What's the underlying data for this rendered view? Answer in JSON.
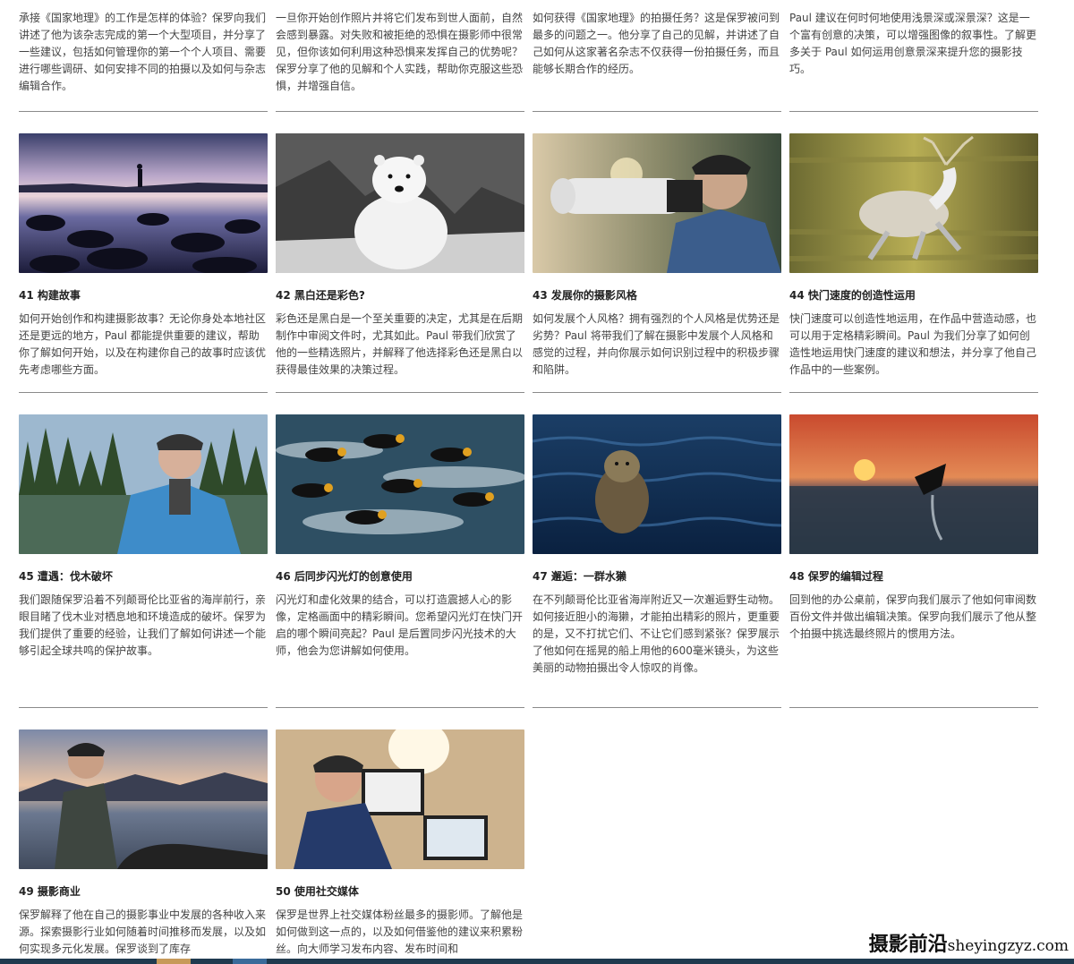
{
  "row0": [
    {
      "desc": "承接《国家地理》的工作是怎样的体验？保罗向我们讲述了他为该杂志完成的第一个大型项目，并分享了一些建议，包括如何管理你的第一个个人项目、需要进行哪些调研、如何安排不同的拍摄以及如何与杂志编辑合作。"
    },
    {
      "desc": "一旦你开始创作照片并将它们发布到世人面前，自然会感到暴露。对失败和被拒绝的恐惧在摄影师中很常见，但你该如何利用这种恐惧来发挥自己的优势呢？保罗分享了他的见解和个人实践，帮助你克服这些恐惧，并增强自信。"
    },
    {
      "desc": "如何获得《国家地理》的拍摄任务？这是保罗被问到最多的问题之一。他分享了自己的见解，并讲述了自己如何从这家著名杂志不仅获得一份拍摄任务，而且能够长期合作的经历。"
    },
    {
      "desc": "Paul 建议在何时何地使用浅景深或深景深？这是一个富有创意的决策，可以增强图像的叙事性。了解更多关于 Paul 如何运用创意景深来提升您的摄影技巧。"
    }
  ],
  "row1": [
    {
      "title": "41 构建故事",
      "desc": "如何开始创作和构建摄影故事？无论你身处本地社区还是更远的地方，Paul 都能提供重要的建议，帮助你了解如何开始，以及在构建你自己的故事时应该优先考虑哪些方面。"
    },
    {
      "title": "42 黑白还是彩色?",
      "desc": "彩色还是黑白是一个至关重要的决定，尤其是在后期制作中审阅文件时，尤其如此。Paul 带我们欣赏了他的一些精选照片，并解释了他选择彩色还是黑白以获得最佳效果的决策过程。"
    },
    {
      "title": "43 发展你的摄影风格",
      "desc": "如何发展个人风格？拥有强烈的个人风格是优势还是劣势？Paul 将带我们了解在摄影中发展个人风格和感觉的过程，并向你展示如何识别过程中的积极步骤和陷阱。"
    },
    {
      "title": "44 快门速度的创造性运用",
      "desc": "快门速度可以创造性地运用，在作品中营造动感，也可以用于定格精彩瞬间。Paul 为我们分享了如何创造性地运用快门速度的建议和想法，并分享了他自己作品中的一些案例。"
    }
  ],
  "row2": [
    {
      "title": "45 遭遇：伐木破坏",
      "desc": "我们跟随保罗沿着不列颠哥伦比亚省的海岸前行，亲眼目睹了伐木业对栖息地和环境造成的破坏。保罗为我们提供了重要的经验，让我们了解如何讲述一个能够引起全球共鸣的保护故事。"
    },
    {
      "title": "46 后同步闪光灯的创意使用",
      "desc": "闪光灯和虚化效果的结合，可以打造震撼人心的影像，定格画面中的精彩瞬间。您希望闪光灯在快门开启的哪个瞬间亮起？Paul 是后置同步闪光技术的大师，他会为您讲解如何使用。"
    },
    {
      "title": "47 邂逅：一群水獭",
      "desc": "在不列颠哥伦比亚省海岸附近又一次邂逅野生动物。如何接近胆小的海獭，才能拍出精彩的照片，更重要的是，又不打扰它们、不让它们感到紧张？保罗展示了他如何在摇晃的船上用他的600毫米镜头，为这些美丽的动物拍摄出令人惊叹的肖像。"
    },
    {
      "title": "48 保罗的编辑过程",
      "desc": "回到他的办公桌前，保罗向我们展示了他如何审阅数百份文件并做出编辑决策。保罗向我们展示了他从整个拍摄中挑选最终照片的惯用方法。"
    }
  ],
  "row3": [
    {
      "title": "49 摄影商业",
      "desc": "保罗解释了他在自己的摄影事业中发展的各种收入来源。探索摄影行业如何随着时间推移而发展，以及如何实现多元化发展。保罗谈到了库存"
    },
    {
      "title": "50 使用社交媒体",
      "desc": "保罗是世界上社交媒体粉丝最多的摄影师。了解他是如何做到这一点的，以及如何借鉴他的建议来积累粉丝。向大师学习发布内容、发布时间和"
    }
  ],
  "watermark": {
    "cn": "摄影前沿",
    "url": "sheyingzyz.com"
  },
  "colors": {
    "divider": "#8a8a8a",
    "title": "#222222",
    "text": "#444444",
    "taskbar": "#1f3a4f"
  }
}
